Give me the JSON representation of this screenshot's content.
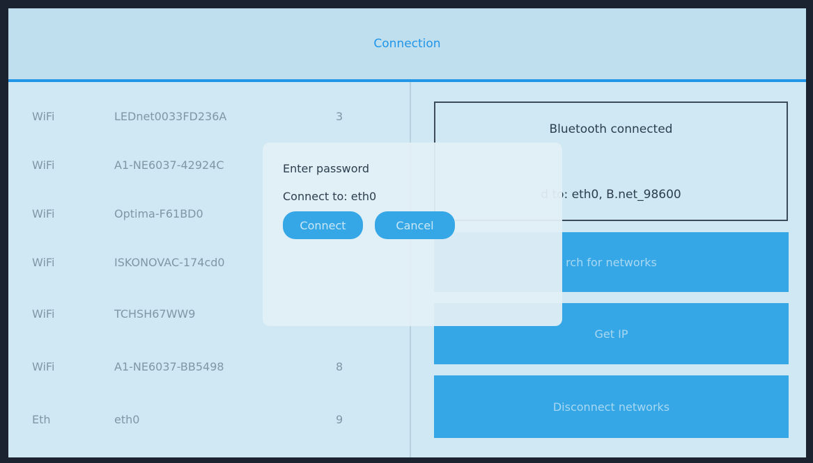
{
  "header": {
    "title": "Connection"
  },
  "networks": [
    {
      "type": "WiFi",
      "ssid": "LEDnet0033FD236A",
      "signal": "3"
    },
    {
      "type": "WiFi",
      "ssid": "A1-NE6037-42924C",
      "signal": ""
    },
    {
      "type": "WiFi",
      "ssid": "Optima-F61BD0",
      "signal": ""
    },
    {
      "type": "WiFi",
      "ssid": "ISKONOVAC-174cd0",
      "signal": ""
    },
    {
      "type": "WiFi",
      "ssid": "TCHSH67WW9",
      "signal": ""
    },
    {
      "type": "WiFi",
      "ssid": "A1-NE6037-BB5498",
      "signal": "8"
    },
    {
      "type": "Eth",
      "ssid": "eth0",
      "signal": "9"
    }
  ],
  "status": {
    "bluetooth": "Bluetooth connected",
    "connected_partial": "d to: eth0, B.net_98600"
  },
  "actions": {
    "search_partial": "rch for networks",
    "get_ip": "Get IP",
    "disconnect": "Disconnect networks"
  },
  "dialog": {
    "title": "Enter password",
    "subtitle": "Connect to: eth0",
    "connect_label": "Connect",
    "cancel_label": "Cancel"
  },
  "colors": {
    "accent": "#35a6e6",
    "header_line": "#2196e8",
    "background": "#cfe8f3"
  }
}
